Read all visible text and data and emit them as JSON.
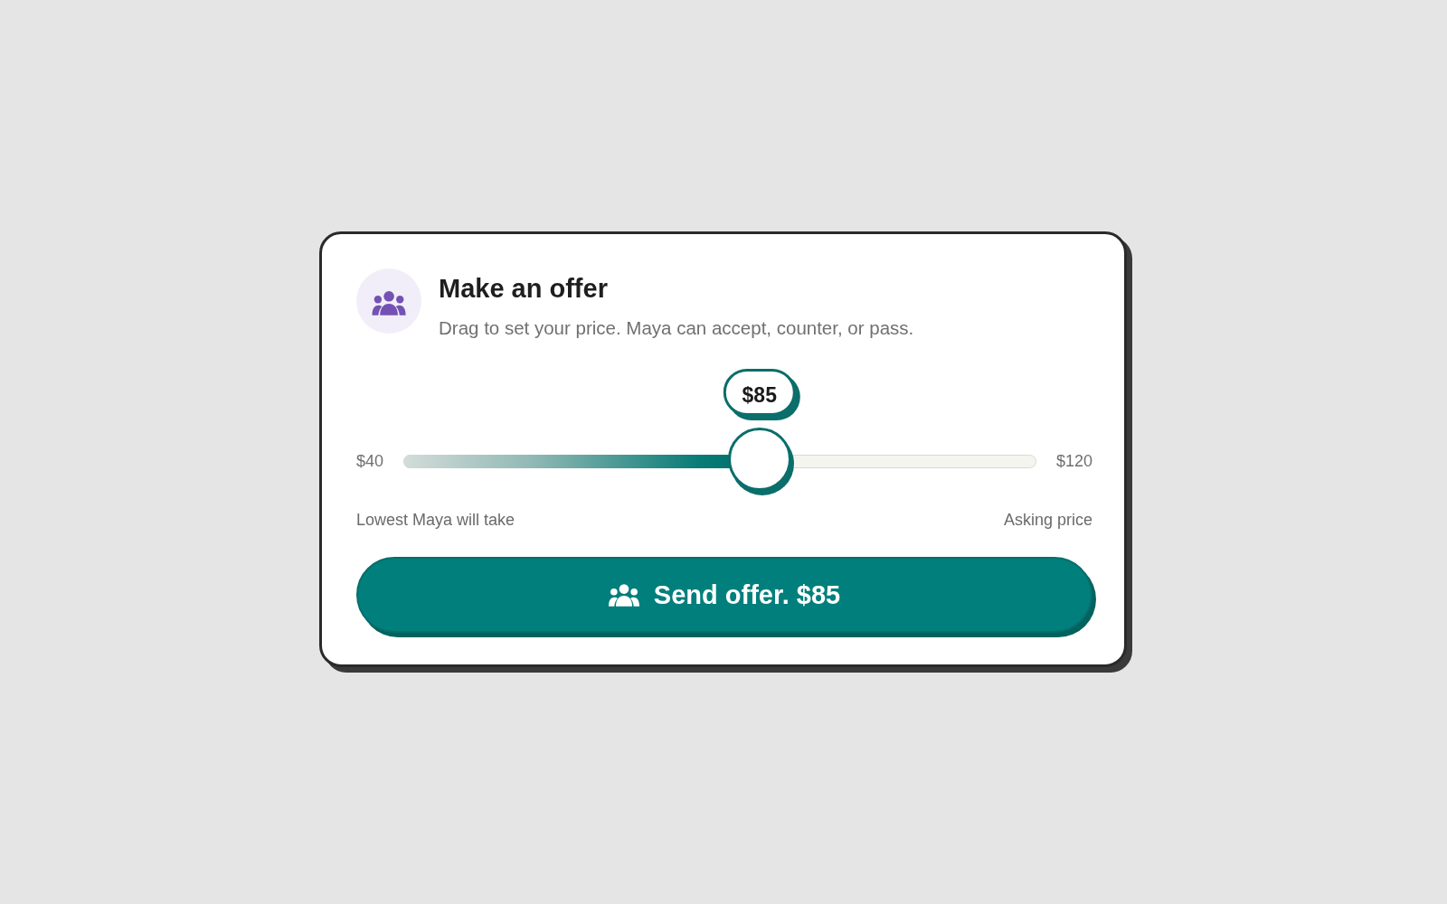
{
  "offer_card": {
    "title": "Make an offer",
    "subtitle": "Drag to set your price. Maya can accept, counter, or pass."
  },
  "price_slider": {
    "value_bubble": "$85",
    "min_label": "$40",
    "max_label": "$120",
    "level": 0.5625,
    "min_caption": "Lowest Maya will take",
    "max_caption": "Asking price"
  },
  "send_button": {
    "label": "Send offer. $85"
  }
}
